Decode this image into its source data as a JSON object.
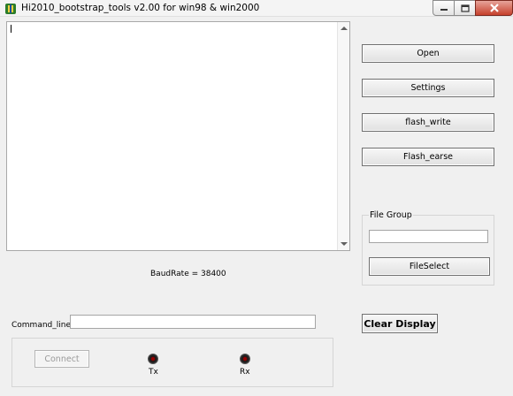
{
  "window": {
    "title": "Hi2010_bootstrap_tools  v2.00 for win98 & win2000",
    "icon": "app-logo-icon",
    "controls": [
      "minimize-icon",
      "maximize-icon",
      "close-icon"
    ]
  },
  "output": {
    "text": ""
  },
  "buttons": {
    "open": "Open",
    "settings": "Settings",
    "flash_write": "flash_write",
    "flash_erase": "Flash_earse"
  },
  "file_group": {
    "title": "File Group",
    "path_value": "",
    "select_label": "FileSelect"
  },
  "status": {
    "baud_rate": "BaudRate = 38400"
  },
  "command": {
    "label": "Command_line",
    "value": ""
  },
  "clear_display": "Clear Display",
  "connection": {
    "connect_label": "Connect",
    "tx_label": "Tx",
    "rx_label": "Rx",
    "led_color": "#8b0000"
  }
}
